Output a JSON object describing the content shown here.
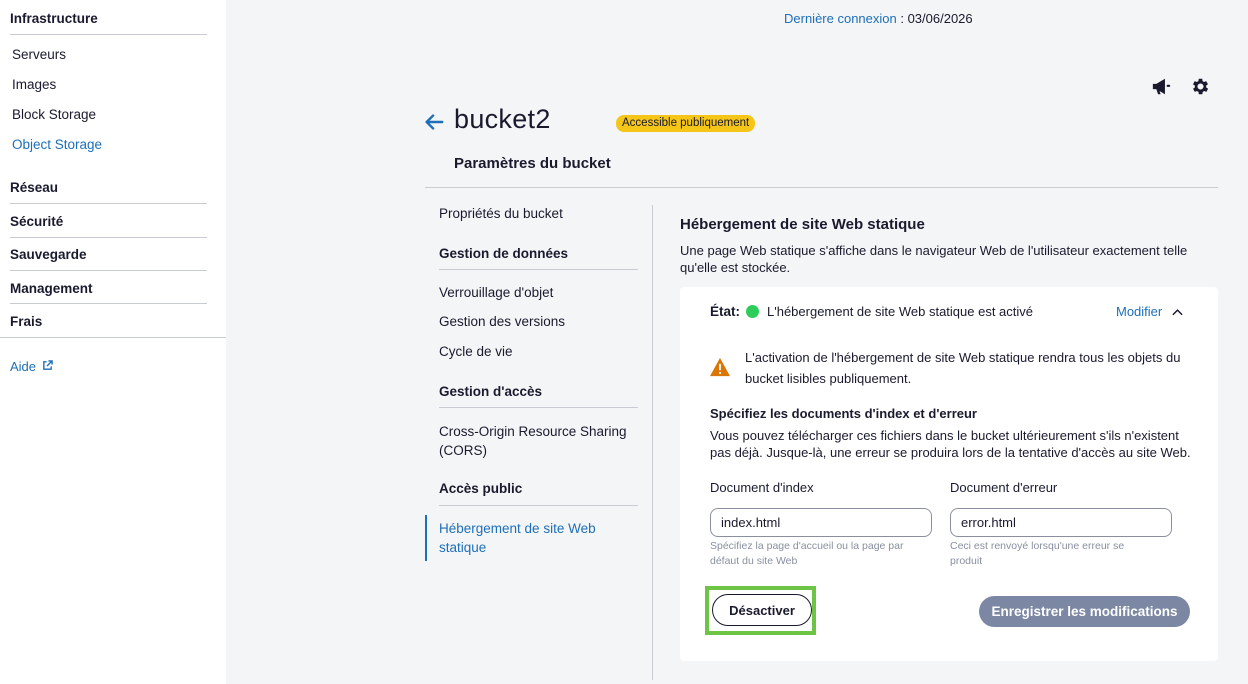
{
  "sidebar": {
    "infrastructure": "Infrastructure",
    "items": [
      "Serveurs",
      "Images",
      "Block Storage",
      "Object Storage"
    ],
    "sections": [
      "Réseau",
      "Sécurité",
      "Sauvegarde",
      "Management",
      "Frais"
    ],
    "help": "Aide",
    "active_item": "Object Storage"
  },
  "header": {
    "last_login_label": "Dernière connexion",
    "last_login_sep": " : ",
    "last_login_value": "03/06/2026",
    "bucket_name": "bucket2",
    "badge": "Accessible publiquement",
    "subtitle": "Paramètres du bucket"
  },
  "content_nav": {
    "properties": "Propriétés du bucket",
    "data_group": "Gestion de données",
    "data_items": [
      "Verrouillage d'objet",
      "Gestion des versions",
      "Cycle de vie"
    ],
    "access_group": "Gestion d'accès",
    "access_items": [
      "Cross-Origin Resource Sharing (CORS)"
    ],
    "public_group": "Accès public",
    "public_items": [
      "Hébergement de site Web statique"
    ]
  },
  "panel": {
    "title": "Hébergement de site Web statique",
    "description": "Une page Web statique s'affiche dans le navigateur Web de l'utilisateur exactement telle qu'elle est stockée.",
    "state_label": "État:",
    "state_text": "L'hébergement de site Web statique est activé",
    "modify": "Modifier",
    "warning": "L'activation de l'hébergement de site Web statique rendra tous les objets du bucket lisibles publiquement.",
    "spec_title": "Spécifiez les documents d'index et d'erreur",
    "spec_desc": "Vous pouvez télécharger ces fichiers dans le bucket ultérieurement s'ils n'existent pas déjà. Jusque-là, une erreur se produira lors de la tentative d'accès au site Web.",
    "index_label": "Document d'index",
    "index_value": "index.html",
    "index_hint": "Spécifiez la page d'accueil ou la page par défaut du site Web",
    "error_label": "Document d'erreur",
    "error_value": "error.html",
    "error_hint": "Ceci est renvoyé lorsqu'une erreur se produit",
    "deactivate": "Désactiver",
    "save": "Enregistrer les modifications"
  },
  "colors": {
    "accent": "#1d6fb8",
    "badge": "#f5c518",
    "status_ok": "#2ecc5b",
    "warning": "#d97706",
    "highlight": "#6dc445",
    "save_button": "#7b87a3"
  }
}
